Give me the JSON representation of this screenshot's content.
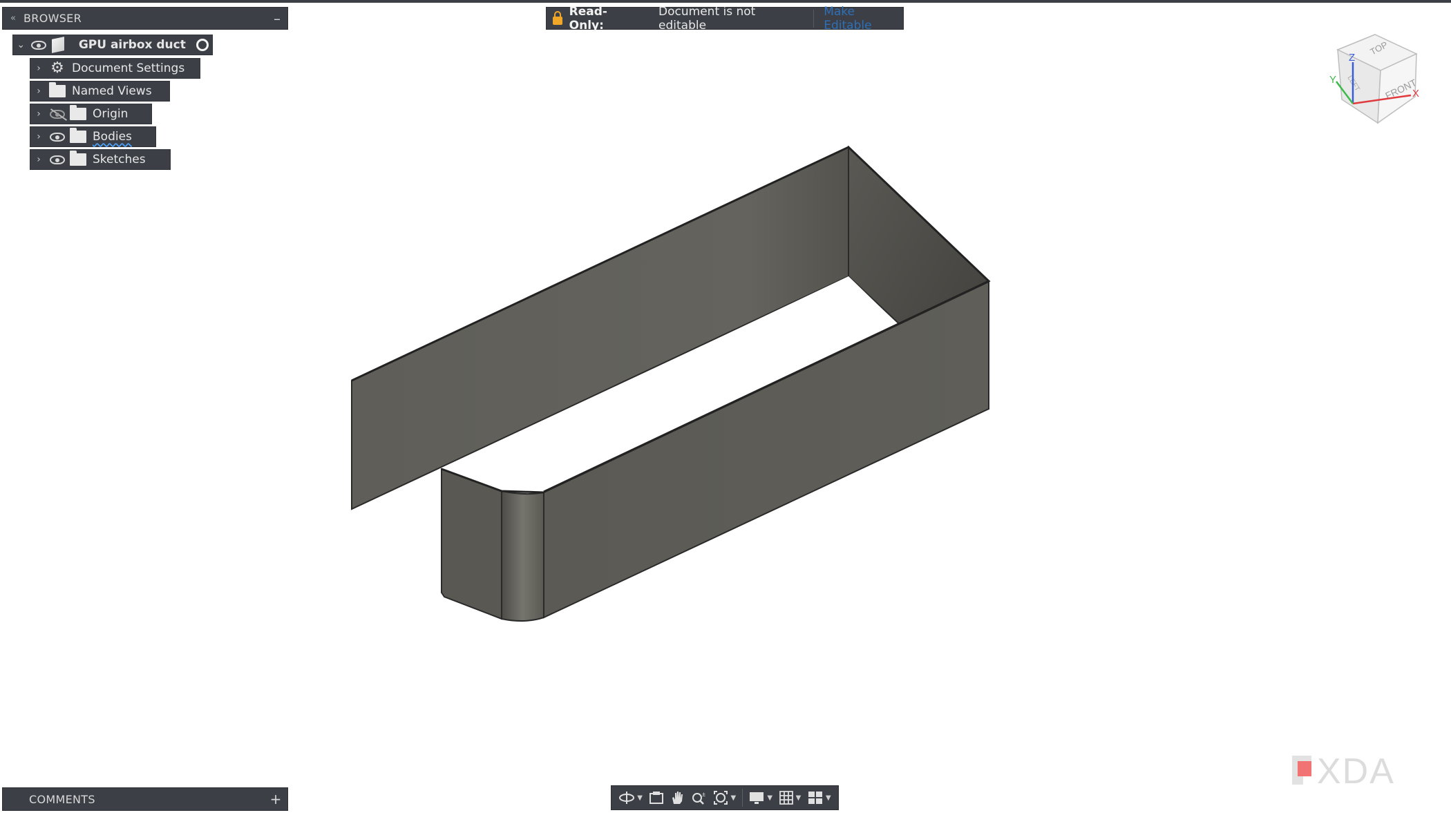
{
  "browser": {
    "title": "BROWSER",
    "root": {
      "label": "GPU airbox duct"
    },
    "items": [
      {
        "label": "Document Settings",
        "icon": "gear-icon"
      },
      {
        "label": "Named Views",
        "icon": "folder-icon"
      },
      {
        "label": "Origin",
        "icon": "folder-icon",
        "visibility": "hidden"
      },
      {
        "label": "Bodies",
        "icon": "folder-icon",
        "visibility": "visible"
      },
      {
        "label": "Sketches",
        "icon": "folder-icon",
        "visibility": "visible"
      }
    ]
  },
  "banner": {
    "title": "Read-Only:",
    "message": "Document is not editable",
    "link": "Make Editable"
  },
  "viewcube": {
    "top": "TOP",
    "front": "FRONT",
    "left": "LEFT",
    "x": "X",
    "y": "Y",
    "z": "Z"
  },
  "comments": {
    "title": "COMMENTS",
    "add": "+"
  },
  "watermark": {
    "text": "XDA"
  },
  "colors": {
    "panel": "#3c4046",
    "model_face": "#5e5d57",
    "model_edge": "#2a2a2a",
    "link": "#2f6fb8",
    "lock": "#f0a626"
  }
}
